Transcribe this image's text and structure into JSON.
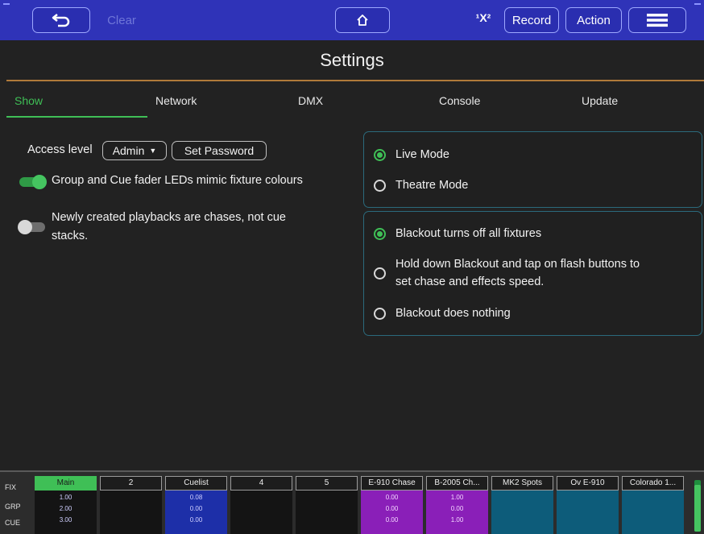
{
  "toolbar": {
    "back_icon": "undo-arrow-icon",
    "clear_label": "Clear",
    "home_icon": "home-icon",
    "fixture_icon_glyph": "¹X²",
    "record_label": "Record",
    "action_label": "Action",
    "menu_icon": "hamburger-menu-icon"
  },
  "page": {
    "title": "Settings"
  },
  "tabs": [
    {
      "label": "Show",
      "active": true
    },
    {
      "label": "Network",
      "active": false
    },
    {
      "label": "DMX",
      "active": false
    },
    {
      "label": "Console",
      "active": false
    },
    {
      "label": "Update",
      "active": false
    }
  ],
  "show_settings": {
    "access_level_label": "Access level",
    "access_level_value": "Admin",
    "set_password_label": "Set Password",
    "toggle1": {
      "label": "Group and Cue fader LEDs mimic fixture colours",
      "on": true
    },
    "toggle2": {
      "label_line1": "Newly created playbacks are chases, not cue",
      "label_line2": "stacks.",
      "on": false
    }
  },
  "mode_options": [
    {
      "label": "Live Mode",
      "checked": true
    },
    {
      "label": "Theatre Mode",
      "checked": false
    }
  ],
  "blackout_options": [
    {
      "label": "Blackout turns off all fixtures",
      "checked": true
    },
    {
      "label_line1": "Hold down Blackout and tap on flash buttons to",
      "label_line2": "set chase and effects speed.",
      "checked": false
    },
    {
      "label": "Blackout does nothing",
      "checked": false
    }
  ],
  "playback_bar": {
    "row_labels": [
      "FIX",
      "GRP",
      "CUE"
    ],
    "columns": [
      {
        "name": "Main",
        "values": [
          "1.00",
          "2.00",
          "3.00"
        ],
        "style": "main"
      },
      {
        "name": "2",
        "values": [],
        "style": "empty"
      },
      {
        "name": "Cuelist",
        "values": [
          "0.08",
          "0.00",
          "0.00"
        ],
        "style": "blue"
      },
      {
        "name": "4",
        "values": [],
        "style": "empty"
      },
      {
        "name": "5",
        "values": [],
        "style": "empty"
      },
      {
        "name": "E-910 Chase",
        "values": [
          "0.00",
          "0.00",
          "0.00"
        ],
        "style": "purple"
      },
      {
        "name": "B-2005 Ch...",
        "values": [
          "1.00",
          "0.00",
          "1.00"
        ],
        "style": "purple"
      },
      {
        "name": "MK2 Spots",
        "values": [],
        "style": "teal"
      },
      {
        "name": "Ov E-910",
        "values": [],
        "style": "teal"
      },
      {
        "name": "Colorado 1...",
        "values": [],
        "style": "teal"
      }
    ],
    "master_level": 0.9
  },
  "colors": {
    "toolbar": "#2f33b8",
    "accent_green": "#3fbf56",
    "title_rule": "#b07a3a",
    "panel_border": "#2b6a7c"
  }
}
